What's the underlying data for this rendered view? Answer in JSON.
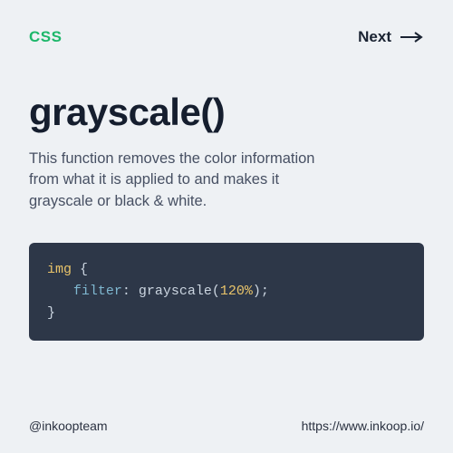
{
  "header": {
    "badge": "CSS",
    "next_label": "Next"
  },
  "main": {
    "title": "grayscale()",
    "description": "This function removes the color information from what it is applied to and makes it grayscale or black & white."
  },
  "code": {
    "selector": "img",
    "brace_open": "{",
    "property": "filter",
    "colon": ":",
    "func_name": "grayscale",
    "paren_open": "(",
    "value": "120%",
    "paren_close": ")",
    "semicolon": ";",
    "brace_close": "}"
  },
  "footer": {
    "handle": "@inkoopteam",
    "url": "https://www.inkoop.io/"
  }
}
